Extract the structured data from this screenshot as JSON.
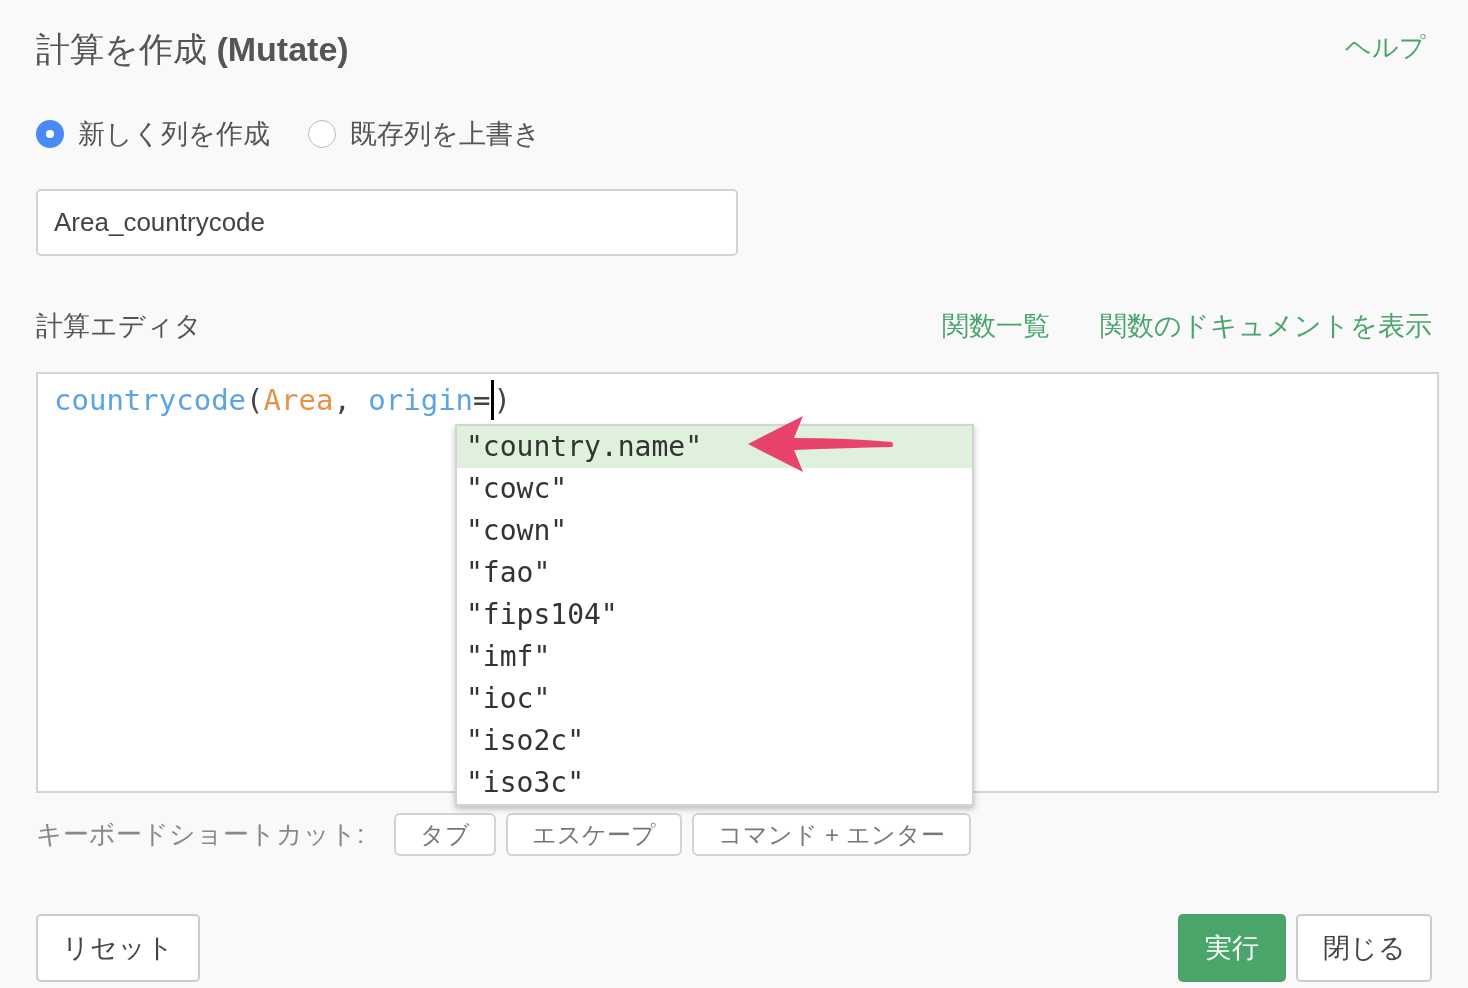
{
  "title": {
    "prefix": "計算を作成",
    "suffix": "(Mutate)"
  },
  "help_link": "ヘルプ",
  "modes": [
    {
      "label": "新しく列を作成",
      "selected": true
    },
    {
      "label": "既存列を上書き",
      "selected": false
    }
  ],
  "column_name": {
    "value": "Area_countrycode"
  },
  "editor": {
    "label": "計算エディタ",
    "links": [
      "関数一覧",
      "関数のドキュメントを表示"
    ],
    "code": [
      {
        "text": "countrycode",
        "kind": "function"
      },
      {
        "text": "(",
        "kind": "punct"
      },
      {
        "text": "Area",
        "kind": "column"
      },
      {
        "text": ", ",
        "kind": "punct"
      },
      {
        "text": "origin",
        "kind": "argument"
      },
      {
        "text": "=",
        "kind": "punct"
      },
      {
        "kind": "cursor"
      },
      {
        "text": ")",
        "kind": "punct"
      }
    ],
    "suggestions": [
      {
        "label": "\"country.name\"",
        "selected": true
      },
      {
        "label": "\"cowc\"",
        "selected": false
      },
      {
        "label": "\"cown\"",
        "selected": false
      },
      {
        "label": "\"fao\"",
        "selected": false
      },
      {
        "label": "\"fips104\"",
        "selected": false
      },
      {
        "label": "\"imf\"",
        "selected": false
      },
      {
        "label": "\"ioc\"",
        "selected": false
      },
      {
        "label": "\"iso2c\"",
        "selected": false
      },
      {
        "label": "\"iso3c\"",
        "selected": false
      }
    ]
  },
  "shortcuts": {
    "label": "キーボードショートカット:",
    "keys": [
      "タブ",
      "エスケープ",
      "コマンド + エンター"
    ]
  },
  "buttons": {
    "reset": "リセット",
    "run": "実行",
    "close": "閉じる"
  }
}
